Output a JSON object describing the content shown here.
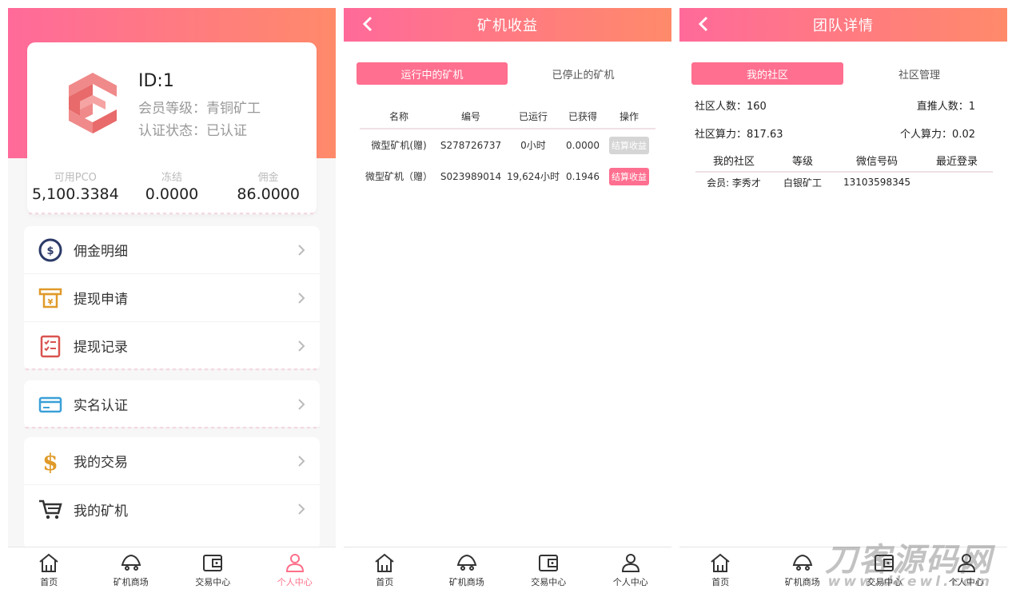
{
  "tabs": [
    {
      "label": "首页",
      "icon": "home-icon"
    },
    {
      "label": "矿机商场",
      "icon": "miner-cart-icon"
    },
    {
      "label": "交易中心",
      "icon": "wallet-icon"
    },
    {
      "label": "个人中心",
      "icon": "user-icon"
    }
  ],
  "colors": {
    "accent": "#ff6f8f",
    "gradient_start": "#ff6a9a",
    "gradient_end": "#ff8a6a"
  },
  "profile": {
    "id": "ID:1",
    "level": "会员等级：青铜矿工",
    "auth": "认证状态：已认证",
    "stats": [
      {
        "label": "可用PCO",
        "value": "5,100.3384"
      },
      {
        "label": "冻结",
        "value": "0.0000"
      },
      {
        "label": "佣金",
        "value": "86.0000"
      }
    ],
    "menu1": [
      {
        "label": "佣金明细",
        "icon": "dollar-coin-icon"
      },
      {
        "label": "提现申请",
        "icon": "atm-withdraw-icon"
      },
      {
        "label": "提现记录",
        "icon": "checklist-icon"
      }
    ],
    "menu2": [
      {
        "label": "实名认证",
        "icon": "id-card-icon"
      }
    ],
    "menu3": [
      {
        "label": "我的交易",
        "icon": "dollar-sign-icon"
      },
      {
        "label": "我的矿机",
        "icon": "cart-icon"
      }
    ],
    "active_tab": "个人中心"
  },
  "mining": {
    "title": "矿机收益",
    "segments": [
      "运行中的矿机",
      "已停止的矿机"
    ],
    "headers": [
      "名称",
      "编号",
      "已运行",
      "已获得",
      "操作"
    ],
    "rows": [
      {
        "name": "微型矿机(赠)",
        "code": "S278726737",
        "run": "0小时",
        "earned": "0.0000",
        "action": "结算收益",
        "style": "grey"
      },
      {
        "name": "微型矿机（赠）",
        "code": "S023989014",
        "run": "19,624小时",
        "earned": "0.1946",
        "action": "结算收益",
        "style": "pink"
      }
    ]
  },
  "team": {
    "title": "团队详情",
    "segments": [
      "我的社区",
      "社区管理"
    ],
    "community_count": "社区人数：160",
    "direct_count": "直推人数：1",
    "community_power": "社区算力：817.63",
    "personal_power": "个人算力：0.02",
    "headers": [
      "我的社区",
      "等级",
      "微信号码",
      "最近登录"
    ],
    "rows": [
      {
        "member": "会员: 李秀才",
        "level": "白银矿工",
        "wechat": "13103598345",
        "last": ""
      }
    ]
  },
  "watermark": {
    "line1": "刀客源码网",
    "line2": "www.dkewl.com"
  }
}
